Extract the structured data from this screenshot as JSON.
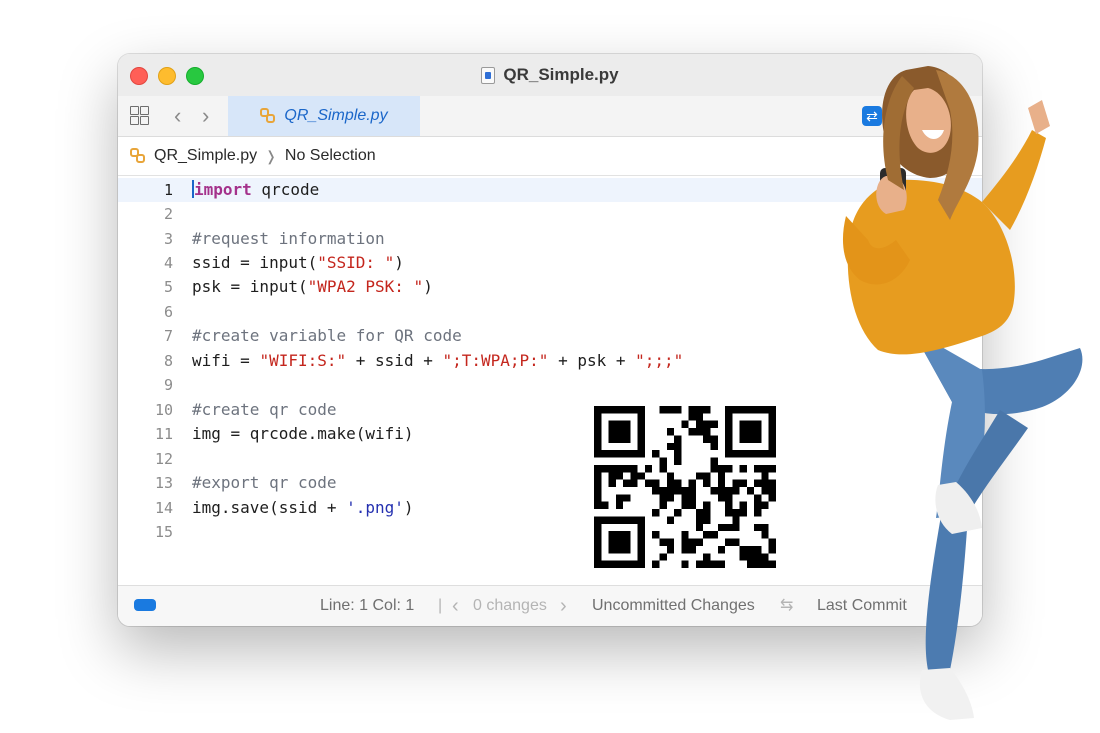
{
  "window": {
    "title": "QR_Simple.py"
  },
  "tabbar": {
    "active_tab": "QR_Simple.py"
  },
  "jumpbar": {
    "file": "QR_Simple.py",
    "selection": "No Selection"
  },
  "editor": {
    "current_line": 1,
    "lines": [
      {
        "no": "1",
        "text": "import qrcode"
      },
      {
        "no": "2",
        "text": ""
      },
      {
        "no": "3",
        "text": "#request information"
      },
      {
        "no": "4",
        "text": "ssid = input(\"SSID: \")"
      },
      {
        "no": "5",
        "text": "psk = input(\"WPA2 PSK: \")"
      },
      {
        "no": "6",
        "text": ""
      },
      {
        "no": "7",
        "text": "#create variable for QR code"
      },
      {
        "no": "8",
        "text": "wifi = \"WIFI:S:\" + ssid + \";T:WPA;P:\" + psk + \";;;\""
      },
      {
        "no": "9",
        "text": ""
      },
      {
        "no": "10",
        "text": "#create qr code"
      },
      {
        "no": "11",
        "text": "img = qrcode.make(wifi)"
      },
      {
        "no": "12",
        "text": ""
      },
      {
        "no": "13",
        "text": "#export qr code"
      },
      {
        "no": "14",
        "text": "img.save(ssid + '.png')"
      },
      {
        "no": "15",
        "text": ""
      }
    ]
  },
  "statusbar": {
    "line_col": "Line: 1  Col: 1",
    "changes": "0 changes",
    "uncommitted": "Uncommitted Changes",
    "last_commit": "Last Commit"
  },
  "colors": {
    "keyword": "#a4318b",
    "string": "#c4261d",
    "comment": "#6d737e",
    "accent": "#1a7ae0",
    "active_tab_bg": "#d7e6f9"
  },
  "icons": {
    "window": [
      "close-icon",
      "minimize-icon",
      "zoom-icon",
      "file-icon"
    ],
    "toolbar": [
      "grid-icon",
      "chevron-left-icon",
      "chevron-right-icon",
      "python-icon",
      "swap-icon"
    ],
    "status": [
      "sidebar-toggle-icon",
      "chevron-left-icon",
      "chevron-right-icon",
      "swap-arrows-icon"
    ]
  }
}
